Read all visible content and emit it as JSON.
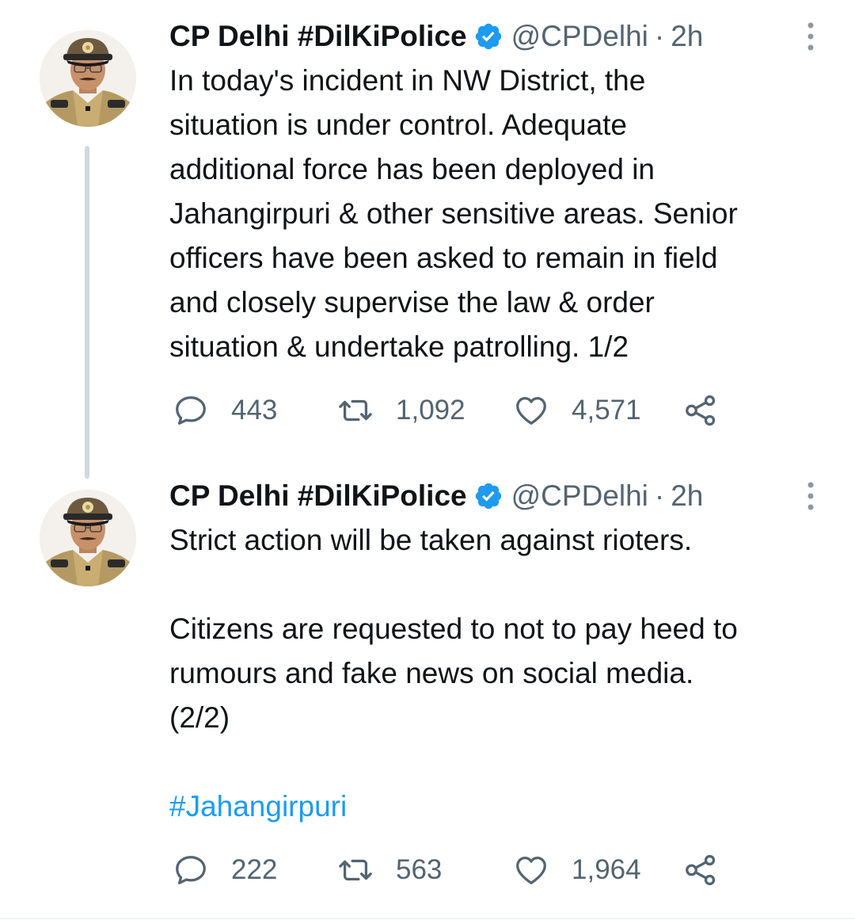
{
  "colors": {
    "text": "#0f1419",
    "secondary": "#536471",
    "link": "#1d9bf0",
    "verified": "#1d9bf0",
    "thread_line": "#cfd9de"
  },
  "tweets": [
    {
      "author": {
        "name": "CP Delhi #DilKiPolice",
        "handle": "@CPDelhi",
        "verified": true,
        "avatar_icon": "police-officer-avatar"
      },
      "separator": "·",
      "time": "2h",
      "body_paragraphs": [
        "In today's incident in NW District, the\nsituation is under control. Adequate\nadditional force has been deployed in\nJahangirpuri & other sensitive areas. Senior\nofficers have been asked to remain in field\nand closely supervise the law & order\nsituation & undertake patrolling. 1/2"
      ],
      "stats": {
        "replies": "443",
        "retweets": "1,092",
        "likes": "4,571"
      }
    },
    {
      "author": {
        "name": "CP Delhi #DilKiPolice",
        "handle": "@CPDelhi",
        "verified": true,
        "avatar_icon": "police-officer-avatar"
      },
      "separator": "·",
      "time": "2h",
      "body_paragraphs": [
        "Strict action will be taken against rioters.",
        "Citizens are requested to not to pay heed to\nrumours and fake news on social media.\n(2/2)"
      ],
      "hashtag": "#Jahangirpuri",
      "stats": {
        "replies": "222",
        "retweets": "563",
        "likes": "1,964"
      }
    }
  ]
}
